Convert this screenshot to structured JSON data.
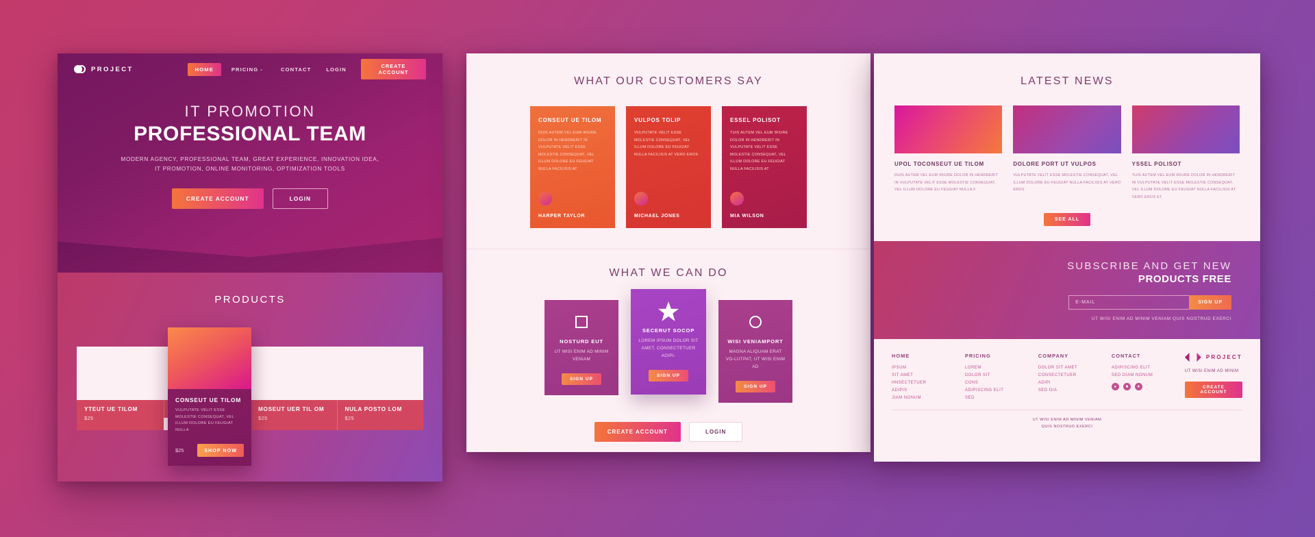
{
  "brand": {
    "name": "PROJECT",
    "logo_icon": "two-circles-icon"
  },
  "left_panel": {
    "nav": {
      "links": [
        {
          "label": "HOME",
          "active": true
        },
        {
          "label": "PRICING -",
          "active": false
        },
        {
          "label": "CONTACT",
          "active": false
        }
      ],
      "login_label": "LOGIN",
      "create_account_label": "CREATE ACCOUNT"
    },
    "hero": {
      "subtitle": "IT PROMOTION",
      "title": "PROFESSIONAL TEAM",
      "description_line1": "MODERN AGENCY, PROFESSIONAL TEAM, GREAT EXPERIENCE, INNOVATION IDEA,",
      "description_line2": "IT PROMOTION, ONLINE MONITORING, OPTIMIZATION TOOLS",
      "primary_button": "CREATE ACCOUNT",
      "secondary_button": "LOGIN"
    },
    "products": {
      "heading": "PRODUCTS",
      "items": [
        {
          "name": "YTEUT UE TILOM",
          "price": "$25"
        },
        {
          "name": "",
          "price": ""
        },
        {
          "name": "MOSEUT UER TIL OM",
          "price": "$25"
        },
        {
          "name": "NULA POSTO LOM",
          "price": "$25"
        }
      ],
      "featured": {
        "title": "CONSEUT UE TILOM",
        "text": "VULPUTATE VELIT ESSE MOLESTIE CONSEQUAT, VEL ILLUM DOLORE EU FEUGIAT NULLA",
        "price": "$25",
        "button": "SHOP NOW"
      }
    }
  },
  "mid_panel": {
    "testimonials_heading": "WHAT OUR CUSTOMERS SAY",
    "testimonials": [
      {
        "title": "CONSEUT UE TILOM",
        "text": "DUIS AUTEM VEL EUM IRIURE DOLOR IN HENDRERIT IN VULPUTATE VELIT ESSE MOLESTIE CONSEQUAT, VEL ILLUM DOLORE EU FEUGIAT NULLA FACILISIS AT",
        "author": "HARPER TAYLOR"
      },
      {
        "title": "VULPOS TOLIP",
        "text": "VULPUTATE VELIT ESSE MOLESTIE CONSEQUAT, VEL ILLUM DOLORE EU FEUGIAT NULLA FACILISIS AT VERO EROS",
        "author": "MICHAEL JONES"
      },
      {
        "title": "ESSEL POLISOT",
        "text": "TUIS AUTEM VEL EUM IRIURE DOLOR IN HENDRERIT IN VULPUTATE VELIT ESSE MOLESTIE CONSEQUAT, VEL ILLUM DOLORE EU FEUGIAT NULLA FACILISIS AT",
        "author": "MIA WILSON"
      }
    ],
    "services_heading": "WHAT WE CAN DO",
    "services": [
      {
        "icon": "square-icon",
        "title": "NOSTURD EUT",
        "text": "UT WISI ENIM AD MINIM VENIAM",
        "button": "SIGN UP"
      },
      {
        "icon": "star-icon",
        "title": "SECERUT SOCOP",
        "text": "LOREM IPSUM DOLOR SIT AMET, CONSECTETUER ADIPI-",
        "button": "SIGN UP"
      },
      {
        "icon": "circle-icon",
        "title": "WISI VENIAMPORT",
        "text": "MAGNA ALIQUAM ERAT VO-LUTPAT, UT WISI ENIM AD",
        "button": "SIGN UP"
      }
    ],
    "cta_primary": "CREATE ACCOUNT",
    "cta_secondary": "LOGIN"
  },
  "right_panel": {
    "news_heading": "LATEST NEWS",
    "news": [
      {
        "title": "UPOL TOCONSEUT UE TILOM",
        "text": "DUIS AUTEM VEL EUM IRIURE DOLOR IN HENDRERIT IN VULPUTATE VELIT ESSE MOLESTIE CONSEQUAT, VEL ILLUM DOLORE EU FEUGIAT NULLA F"
      },
      {
        "title": "DOLORE PORT UT VULPOS",
        "text": "VULPUTATE VELIT ESSE MOLESTIE CONSEQUAT, VEL ILLUM DOLORE EU FEUGIAT NULLA FACILISIS AT VERO EROS"
      },
      {
        "title": "YSSEL POLISOT",
        "text": "TUIS AUTEM VEL EUM IRIURE DOLOR IN HENDRERIT IN VULPUTATE VELIT ESSE MOLESTIE CONSEQUAT, VEL ILLUM DOLORE EU FEUGIAT NULLA FACILISIS AT VERO EROS ET"
      }
    ],
    "see_all_label": "SEE ALL",
    "subscribe": {
      "line1": "SUBSCRIBE AND GET NEW",
      "line2": "PRODUCTS FREE",
      "email_placeholder": "E-MAIL",
      "email_value": "",
      "sign_up_label": "SIGN UP",
      "note": "UT WISI ENIM AD MINIM VENIAM QUIS NOSTRUD EXERCI"
    },
    "footer": {
      "columns": [
        {
          "head": "HOME",
          "items": [
            "IPSUM",
            "SIT AMET",
            "HNSECTETUER",
            "ADIPIS",
            "JIAM NONUM"
          ]
        },
        {
          "head": "PRICING",
          "items": [
            "LOREM",
            "DOLOR SIT",
            "CONS",
            "ADIPISCING ELIT",
            "SED"
          ]
        },
        {
          "head": "COMPANY",
          "items": [
            "DOLOR SIT AMET",
            "CONSECTETUER",
            "ADIPI",
            "SED DIA"
          ]
        },
        {
          "head": "CONTACT",
          "items": [
            "ADIPISCING ELIT",
            "SED DIAM NONUM"
          ]
        }
      ],
      "socials": [
        "circle-icon",
        "square-icon",
        "star-icon"
      ],
      "brand_name": "PROJECT",
      "brand_note": "UT WISI ENIM AD MINIM",
      "brand_cta": "CREATE ACCOUNT",
      "bottom_line1": "UT WISI ENIM AD MINIM VENIAM",
      "bottom_line2": "QUIS NOSTRUD EXERCI"
    }
  },
  "colors": {
    "accent_orange": "#f4743b",
    "accent_pink": "#e0338b",
    "deep_purple": "#7b1a5c",
    "panel_bg": "#fdf0f4"
  }
}
